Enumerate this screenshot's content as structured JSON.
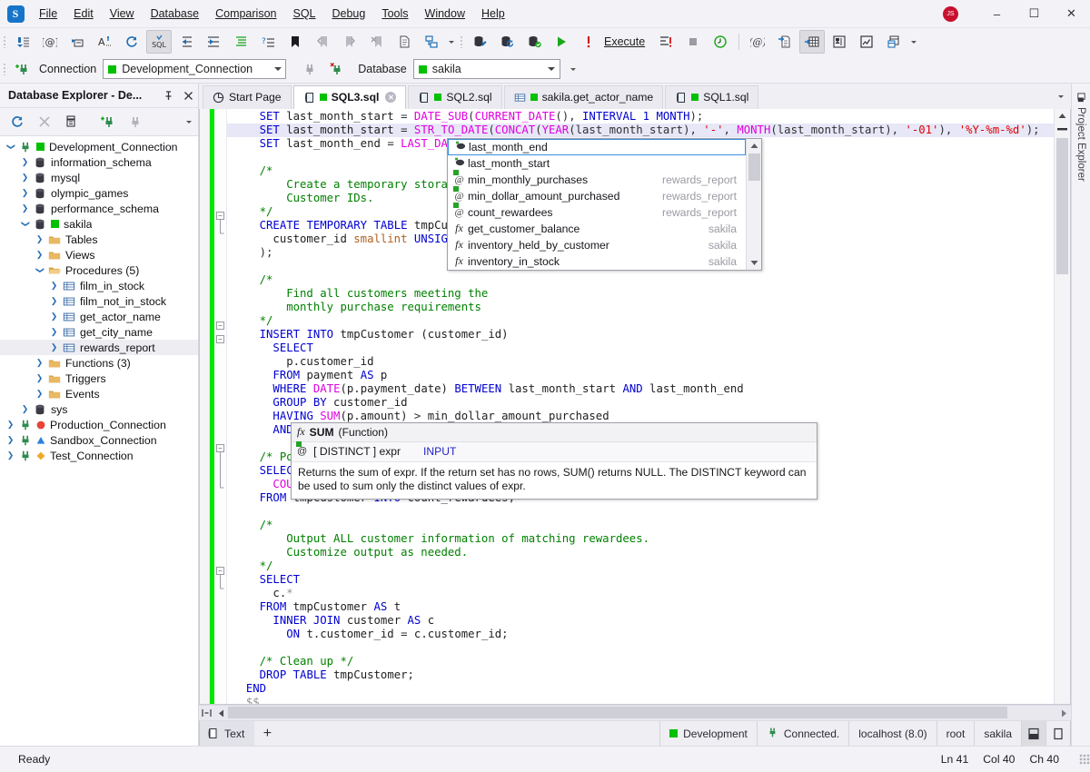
{
  "window": {
    "logo_letter": "S",
    "avatar_initials": "JS",
    "minimize": "–",
    "maximize": "☐",
    "close": "✕"
  },
  "menu": {
    "items": [
      "File",
      "Edit",
      "View",
      "Database",
      "Comparison",
      "SQL",
      "Debug",
      "Tools",
      "Window",
      "Help"
    ]
  },
  "toolbar_main": {
    "icons": [
      "insert-snippet-icon",
      "at-variable-icon",
      "goto-definition-icon",
      "uppercase-text-icon",
      "refresh-icon",
      "validate-sql-icon",
      "outdent-icon",
      "indent-icon",
      "format-sql-icon",
      "comment-lines-icon",
      "bookmark-icon",
      "prev-bookmark-icon",
      "next-bookmark-icon",
      "clear-bookmarks-icon",
      "new-document-icon",
      "copy-layout-icon"
    ],
    "execute_label": "Execute",
    "right_icons": [
      "database-edit-icon",
      "database-refresh-icon",
      "database-check-icon",
      "run-icon",
      "execute-warning-icon",
      "execute-to-file-icon",
      "stop-icon",
      "execution-history-icon",
      "parameters-icon",
      "script-results-icon",
      "grid-results-icon",
      "results-settings-icon",
      "chart-results-icon",
      "export-results-icon"
    ]
  },
  "toolbar_connection": {
    "new_connection_icon": "new-connection-icon",
    "connection_label": "Connection",
    "connection_value": "Development_Connection",
    "connection_color": "#00c000",
    "disconnect_icon": "disconnect-icon",
    "reconnect_icon": "reconnect-icon",
    "database_label": "Database",
    "database_value": "sakila",
    "database_color": "#00c000"
  },
  "explorer": {
    "title": "Database Explorer - De...",
    "pin_icon": "pin-icon",
    "close_icon": "close-icon",
    "toolbar_icons": [
      "refresh-icon",
      "disconnect-x-icon",
      "duplicate-icon",
      "new-connection-icon",
      "plug-icon",
      "overflow-chevron-icon"
    ],
    "tree": [
      {
        "label": "Development_Connection",
        "indent": 0,
        "twisty": "down",
        "icon": "plug-icon",
        "dot": "#00c000",
        "selected": false
      },
      {
        "label": "information_schema",
        "indent": 1,
        "twisty": "right",
        "icon": "database-icon",
        "dot": "",
        "selected": false
      },
      {
        "label": "mysql",
        "indent": 1,
        "twisty": "right",
        "icon": "database-icon",
        "dot": "",
        "selected": false
      },
      {
        "label": "olympic_games",
        "indent": 1,
        "twisty": "right",
        "icon": "database-icon",
        "dot": "",
        "selected": false
      },
      {
        "label": "performance_schema",
        "indent": 1,
        "twisty": "right",
        "icon": "database-icon",
        "dot": "",
        "selected": false
      },
      {
        "label": "sakila",
        "indent": 1,
        "twisty": "down",
        "icon": "database-icon",
        "dot": "#00c000",
        "selected": false
      },
      {
        "label": "Tables",
        "indent": 2,
        "twisty": "right",
        "icon": "folder-icon",
        "dot": "",
        "selected": false
      },
      {
        "label": "Views",
        "indent": 2,
        "twisty": "right",
        "icon": "folder-icon",
        "dot": "",
        "selected": false
      },
      {
        "label": "Procedures (5)",
        "indent": 2,
        "twisty": "down",
        "icon": "folder-open-icon",
        "dot": "",
        "selected": false
      },
      {
        "label": "film_in_stock",
        "indent": 3,
        "twisty": "right",
        "icon": "procedure-icon",
        "dot": "",
        "selected": false
      },
      {
        "label": "film_not_in_stock",
        "indent": 3,
        "twisty": "right",
        "icon": "procedure-icon",
        "dot": "",
        "selected": false
      },
      {
        "label": "get_actor_name",
        "indent": 3,
        "twisty": "right",
        "icon": "procedure-icon",
        "dot": "",
        "selected": false
      },
      {
        "label": "get_city_name",
        "indent": 3,
        "twisty": "right",
        "icon": "procedure-icon",
        "dot": "",
        "selected": false
      },
      {
        "label": "rewards_report",
        "indent": 3,
        "twisty": "right",
        "icon": "procedure-icon",
        "dot": "",
        "selected": true
      },
      {
        "label": "Functions (3)",
        "indent": 2,
        "twisty": "right",
        "icon": "folder-icon",
        "dot": "",
        "selected": false
      },
      {
        "label": "Triggers",
        "indent": 2,
        "twisty": "right",
        "icon": "folder-icon",
        "dot": "",
        "selected": false
      },
      {
        "label": "Events",
        "indent": 2,
        "twisty": "right",
        "icon": "folder-icon",
        "dot": "",
        "selected": false
      },
      {
        "label": "sys",
        "indent": 1,
        "twisty": "right",
        "icon": "database-icon",
        "dot": "",
        "selected": false
      },
      {
        "label": "Production_Connection",
        "indent": 0,
        "twisty": "right",
        "icon": "plug-icon",
        "dot": "#e8443a",
        "dotshape": "circle",
        "selected": false
      },
      {
        "label": "Sandbox_Connection",
        "indent": 0,
        "twisty": "right",
        "icon": "plug-icon",
        "dot": "#2b7fe0",
        "dotshape": "triangle",
        "selected": false
      },
      {
        "label": "Test_Connection",
        "indent": 0,
        "twisty": "right",
        "icon": "plug-icon",
        "dot": "#f0a828",
        "dotshape": "diamond",
        "selected": false
      }
    ]
  },
  "tabs": [
    {
      "label": "Start Page",
      "icon": "start-page-icon",
      "active": false,
      "dirty": false,
      "status_color": ""
    },
    {
      "label": "SQL3.sql",
      "icon": "sql-doc-icon",
      "active": true,
      "dirty": true,
      "status_color": "#00c000"
    },
    {
      "label": "SQL2.sql",
      "icon": "sql-doc-icon",
      "active": false,
      "dirty": false,
      "status_color": "#00c000"
    },
    {
      "label": "sakila.get_actor_name",
      "icon": "procedure-icon",
      "active": false,
      "dirty": false,
      "status_color": "#00c000"
    },
    {
      "label": "SQL1.sql",
      "icon": "sql-doc-icon",
      "active": false,
      "dirty": false,
      "status_color": "#00c000"
    }
  ],
  "right_strip": {
    "label": "Project Explorer",
    "icon": "project-explorer-icon"
  },
  "editor": {
    "lines": [
      [
        {
          "t": "    ",
          "c": "pl"
        },
        {
          "t": "SET",
          "c": "kw"
        },
        {
          "t": " last_month_start ",
          "c": "pl"
        },
        {
          "t": "=",
          "c": "op"
        },
        {
          "t": " ",
          "c": "pl"
        },
        {
          "t": "DATE_SUB",
          "c": "fn"
        },
        {
          "t": "(",
          "c": "op"
        },
        {
          "t": "CURRENT_DATE",
          "c": "fn"
        },
        {
          "t": "(),",
          "c": "op"
        },
        {
          "t": " ",
          "c": "pl"
        },
        {
          "t": "INTERVAL",
          "c": "kw"
        },
        {
          "t": " ",
          "c": "pl"
        },
        {
          "t": "1",
          "c": "num"
        },
        {
          "t": " ",
          "c": "pl"
        },
        {
          "t": "MONTH",
          "c": "kw"
        },
        {
          "t": ");",
          "c": "op"
        }
      ],
      [
        {
          "t": "    ",
          "c": "pl"
        },
        {
          "t": "SET",
          "c": "kw"
        },
        {
          "t": " last_month_start ",
          "c": "pl"
        },
        {
          "t": "=",
          "c": "op"
        },
        {
          "t": " ",
          "c": "pl"
        },
        {
          "t": "STR_TO_DATE",
          "c": "fn"
        },
        {
          "t": "(",
          "c": "op"
        },
        {
          "t": "CONCAT",
          "c": "fn"
        },
        {
          "t": "(",
          "c": "op"
        },
        {
          "t": "YEAR",
          "c": "fn"
        },
        {
          "t": "(last_month_start), ",
          "c": "op"
        },
        {
          "t": "'-'",
          "c": "str"
        },
        {
          "t": ", ",
          "c": "op"
        },
        {
          "t": "MONTH",
          "c": "fn"
        },
        {
          "t": "(last_month_start), ",
          "c": "op"
        },
        {
          "t": "'-01'",
          "c": "str"
        },
        {
          "t": "), ",
          "c": "op"
        },
        {
          "t": "'%Y-%m-%d'",
          "c": "str"
        },
        {
          "t": ");",
          "c": "op"
        }
      ],
      [
        {
          "t": "    ",
          "c": "pl"
        },
        {
          "t": "SET",
          "c": "kw"
        },
        {
          "t": " last_month_end ",
          "c": "pl"
        },
        {
          "t": "=",
          "c": "op"
        },
        {
          "t": " ",
          "c": "pl"
        },
        {
          "t": "LAST_DAY",
          "c": "fn"
        },
        {
          "t": "(las",
          "c": "op"
        }
      ],
      [
        {
          "t": "",
          "c": "pl"
        }
      ],
      [
        {
          "t": "    /*",
          "c": "cmt"
        }
      ],
      [
        {
          "t": "        Create a temporary storage ar",
          "c": "cmt"
        }
      ],
      [
        {
          "t": "        Customer IDs.",
          "c": "cmt"
        }
      ],
      [
        {
          "t": "    */",
          "c": "cmt"
        }
      ],
      [
        {
          "t": "    ",
          "c": "pl"
        },
        {
          "t": "CREATE",
          "c": "kw"
        },
        {
          "t": " ",
          "c": "pl"
        },
        {
          "t": "TEMPORARY",
          "c": "kw"
        },
        {
          "t": " ",
          "c": "pl"
        },
        {
          "t": "TABLE",
          "c": "kw"
        },
        {
          "t": " tmpCustome",
          "c": "pl"
        }
      ],
      [
        {
          "t": "      customer_id ",
          "c": "pl"
        },
        {
          "t": "smallint",
          "c": "typ"
        },
        {
          "t": " ",
          "c": "pl"
        },
        {
          "t": "UNSIGNED",
          "c": "kw"
        },
        {
          "t": " ",
          "c": "pl"
        }
      ],
      [
        {
          "t": "    );",
          "c": "op"
        }
      ],
      [
        {
          "t": "",
          "c": "pl"
        }
      ],
      [
        {
          "t": "    /*",
          "c": "cmt"
        }
      ],
      [
        {
          "t": "        Find all customers meeting the",
          "c": "cmt"
        }
      ],
      [
        {
          "t": "        monthly purchase requirements",
          "c": "cmt"
        }
      ],
      [
        {
          "t": "    */",
          "c": "cmt"
        }
      ],
      [
        {
          "t": "    ",
          "c": "pl"
        },
        {
          "t": "INSERT",
          "c": "kw"
        },
        {
          "t": " ",
          "c": "pl"
        },
        {
          "t": "INTO",
          "c": "kw"
        },
        {
          "t": " tmpCustomer (customer_id)",
          "c": "pl"
        }
      ],
      [
        {
          "t": "      ",
          "c": "pl"
        },
        {
          "t": "SELECT",
          "c": "kw"
        }
      ],
      [
        {
          "t": "        p.customer_id",
          "c": "pl"
        }
      ],
      [
        {
          "t": "      ",
          "c": "pl"
        },
        {
          "t": "FROM",
          "c": "kw"
        },
        {
          "t": " payment ",
          "c": "pl"
        },
        {
          "t": "AS",
          "c": "kw"
        },
        {
          "t": " p",
          "c": "pl"
        }
      ],
      [
        {
          "t": "      ",
          "c": "pl"
        },
        {
          "t": "WHERE",
          "c": "kw"
        },
        {
          "t": " ",
          "c": "pl"
        },
        {
          "t": "DATE",
          "c": "fn"
        },
        {
          "t": "(p.payment_date) ",
          "c": "pl"
        },
        {
          "t": "BETWEEN",
          "c": "kw"
        },
        {
          "t": " last_month_start ",
          "c": "pl"
        },
        {
          "t": "AND",
          "c": "kw"
        },
        {
          "t": " last_month_end",
          "c": "pl"
        }
      ],
      [
        {
          "t": "      ",
          "c": "pl"
        },
        {
          "t": "GROUP BY",
          "c": "kw"
        },
        {
          "t": " customer_id",
          "c": "pl"
        }
      ],
      [
        {
          "t": "      ",
          "c": "pl"
        },
        {
          "t": "HAVING",
          "c": "kw"
        },
        {
          "t": " ",
          "c": "pl"
        },
        {
          "t": "SUM",
          "c": "fn"
        },
        {
          "t": "(p.amount) ",
          "c": "pl"
        },
        {
          "t": ">",
          "c": "op"
        },
        {
          "t": " min_dollar_amount_purchased",
          "c": "pl"
        }
      ],
      [
        {
          "t": "      ",
          "c": "pl"
        },
        {
          "t": "AND",
          "c": "kw"
        },
        {
          "t": " ",
          "c": "pl"
        },
        {
          "t": "COU",
          "c": "fn"
        }
      ],
      [
        {
          "t": "",
          "c": "pl"
        }
      ],
      [
        {
          "t": "    /* Popula",
          "c": "cmt"
        }
      ],
      [
        {
          "t": "    ",
          "c": "pl"
        },
        {
          "t": "SELECT",
          "c": "kw"
        }
      ],
      [
        {
          "t": "      ",
          "c": "pl"
        },
        {
          "t": "COUNT",
          "c": "fn"
        },
        {
          "t": "(*",
          "c": "pl"
        }
      ],
      [
        {
          "t": "    ",
          "c": "pl"
        },
        {
          "t": "FROM",
          "c": "kw"
        },
        {
          "t": " tmpCustomer ",
          "c": "pl"
        },
        {
          "t": "INTO",
          "c": "kw"
        },
        {
          "t": " count_rewardees",
          "c": "pl"
        },
        {
          "t": ";",
          "c": "op"
        }
      ],
      [
        {
          "t": "",
          "c": "pl"
        }
      ],
      [
        {
          "t": "    /*",
          "c": "cmt"
        }
      ],
      [
        {
          "t": "        Output ALL customer information of matching rewardees.",
          "c": "cmt"
        }
      ],
      [
        {
          "t": "        Customize output as needed.",
          "c": "cmt"
        }
      ],
      [
        {
          "t": "    */",
          "c": "cmt"
        }
      ],
      [
        {
          "t": "    ",
          "c": "pl"
        },
        {
          "t": "SELECT",
          "c": "kw"
        }
      ],
      [
        {
          "t": "      c.",
          "c": "pl"
        },
        {
          "t": "*",
          "c": "gry"
        }
      ],
      [
        {
          "t": "    ",
          "c": "pl"
        },
        {
          "t": "FROM",
          "c": "kw"
        },
        {
          "t": " tmpCustomer ",
          "c": "pl"
        },
        {
          "t": "AS",
          "c": "kw"
        },
        {
          "t": " t",
          "c": "pl"
        }
      ],
      [
        {
          "t": "      ",
          "c": "pl"
        },
        {
          "t": "INNER JOIN",
          "c": "kw"
        },
        {
          "t": " customer ",
          "c": "pl"
        },
        {
          "t": "AS",
          "c": "kw"
        },
        {
          "t": " c",
          "c": "pl"
        }
      ],
      [
        {
          "t": "        ",
          "c": "pl"
        },
        {
          "t": "ON",
          "c": "kw"
        },
        {
          "t": " t.customer_id ",
          "c": "pl"
        },
        {
          "t": "=",
          "c": "op"
        },
        {
          "t": " c.customer_id",
          "c": "pl"
        },
        {
          "t": ";",
          "c": "op"
        }
      ],
      [
        {
          "t": "",
          "c": "pl"
        }
      ],
      [
        {
          "t": "    /* Clean up */",
          "c": "cmt"
        }
      ],
      [
        {
          "t": "    ",
          "c": "pl"
        },
        {
          "t": "DROP",
          "c": "kw"
        },
        {
          "t": " ",
          "c": "pl"
        },
        {
          "t": "TABLE",
          "c": "kw"
        },
        {
          "t": " tmpCustomer",
          "c": "pl"
        },
        {
          "t": ";",
          "c": "op"
        }
      ],
      [
        {
          "t": "  ",
          "c": "pl"
        },
        {
          "t": "END",
          "c": "kw"
        }
      ],
      [
        {
          "t": "  ",
          "c": "pl"
        },
        {
          "t": "$$",
          "c": "gry"
        }
      ]
    ],
    "highlight_line_index": 1
  },
  "autocomplete": {
    "items": [
      {
        "name": "last_month_end",
        "source": "",
        "kind": "variable",
        "selected": true
      },
      {
        "name": "last_month_start",
        "source": "",
        "kind": "variable",
        "selected": false
      },
      {
        "name": "min_monthly_purchases",
        "source": "rewards_report",
        "kind": "parameter",
        "selected": false
      },
      {
        "name": "min_dollar_amount_purchased",
        "source": "rewards_report",
        "kind": "parameter",
        "selected": false
      },
      {
        "name": "count_rewardees",
        "source": "rewards_report",
        "kind": "parameter",
        "selected": false
      },
      {
        "name": "get_customer_balance",
        "source": "sakila",
        "kind": "function",
        "selected": false
      },
      {
        "name": "inventory_held_by_customer",
        "source": "sakila",
        "kind": "function",
        "selected": false
      },
      {
        "name": "inventory_in_stock",
        "source": "sakila",
        "kind": "function",
        "selected": false
      }
    ]
  },
  "tooltip": {
    "title_name": "SUM",
    "title_kind": "(Function)",
    "signature": "[ DISTINCT ] expr",
    "signature_tag": "INPUT",
    "description": "Returns the sum of expr. If the return set has no rows, SUM() returns NULL. The DISTINCT keyword can be used to sum only the distinct values of expr."
  },
  "results_bar": {
    "tab_label": "Text",
    "tab_icon": "text-results-icon",
    "add_label": "+",
    "connection": "Development",
    "connection_color": "#00c000",
    "status": "Connected.",
    "server": "localhost (8.0)",
    "user": "root",
    "database": "sakila",
    "layout_icons": [
      "split-horizontal-icon",
      "split-vertical-icon"
    ]
  },
  "statusbar": {
    "message": "Ready",
    "line": "Ln 41",
    "col": "Col 40",
    "ch": "Ch 40"
  }
}
